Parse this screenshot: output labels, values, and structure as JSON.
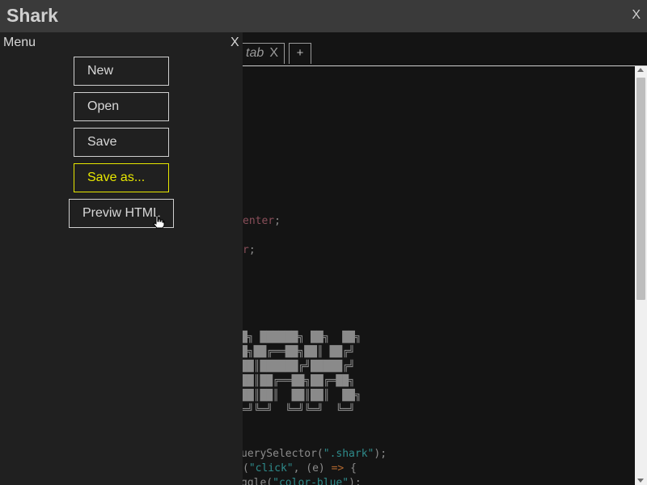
{
  "app": {
    "title": "Shark",
    "close_label": "X"
  },
  "tabs": [
    {
      "label": "tab",
      "close_label": "X"
    }
  ],
  "new_tab_label": "+",
  "menu": {
    "title": "Menu",
    "close_label": "X",
    "items": [
      {
        "label": "New"
      },
      {
        "label": "Open"
      },
      {
        "label": "Save"
      },
      {
        "label": "Save as...",
        "hovered": true
      },
      {
        "label": "Previw HTML"
      }
    ]
  },
  "code": {
    "css_line1": {
      "prop": "enter",
      "punct": ";"
    },
    "css_line2": {
      "prop": "r",
      "punct": ";"
    },
    "ascii_art": [
      "█╗ ██████╗ ██╗  ██╗",
      "█╗██╔══██╗██║ ██╔╝",
      "██║██████╔╝█████╔╝",
      "██║██╔══██╗██╔═██╗",
      "██║██║  ██║██║  ██╗",
      "═╝╚═╝  ╚═╝╚═╝  ╚═╝"
    ],
    "js_line1": {
      "pre": "uerySelector(",
      "str": "\".shark\"",
      "post": ");"
    },
    "js_line2": {
      "pre": "(",
      "str": "\"click\"",
      "mid": ", (e) ",
      "arrow": "=>",
      "post": " {"
    },
    "js_line3": {
      "pre": "ggle(",
      "str": "\"color-blue\"",
      "post": ");"
    }
  },
  "colors": {
    "hover_accent": "#e8e800",
    "string": "#2e8b8b",
    "property": "#8a4f5a",
    "arrow": "#b0672e"
  }
}
